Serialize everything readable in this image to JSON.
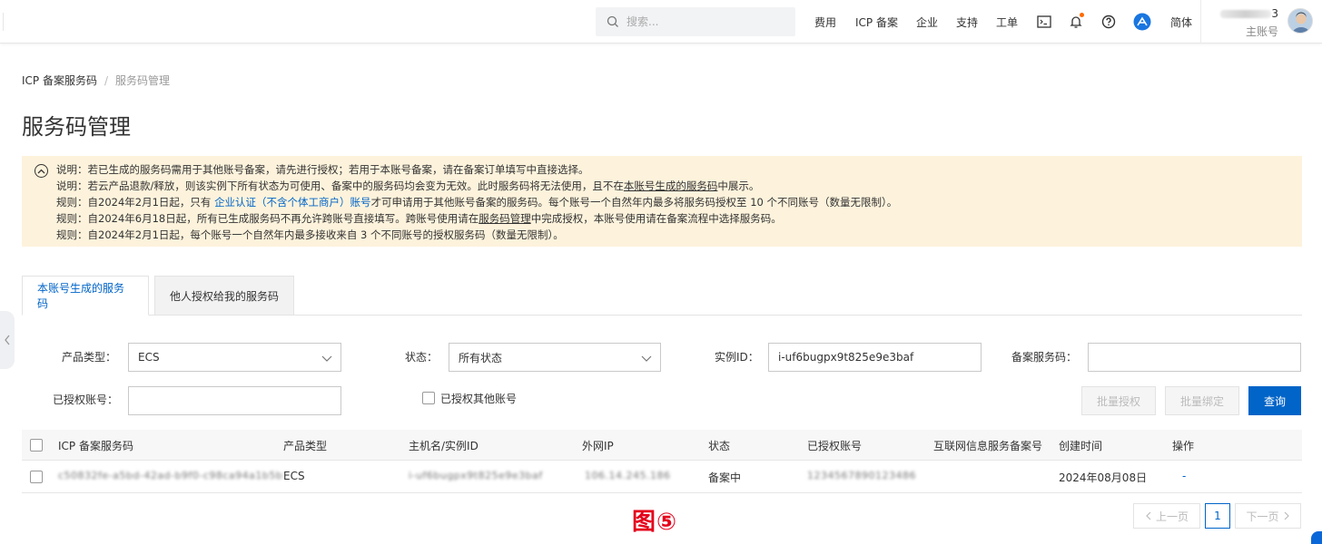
{
  "header": {
    "search_placeholder": "搜索...",
    "nav": [
      "费用",
      "ICP 备案",
      "企业",
      "支持",
      "工单"
    ],
    "lang": "简体",
    "user_suffix": "3",
    "user_role": "主账号",
    "accent": "#ff6a00"
  },
  "breadcrumb": {
    "root": "ICP 备案服务码",
    "sep": "/",
    "current": "服务码管理"
  },
  "page_title": "服务码管理",
  "notice": {
    "line1": "说明：若已生成的服务码需用于其他账号备案，请先进行授权；若用于本账号备案，请在备案订单填写中直接选择。",
    "line2_a": "说明：若云产品退款/释放，则该实例下所有状态为可使用、备案中的服务码均会变为无效。此时服务码将无法使用，且不在",
    "line2_link": "本账号生成的服务码",
    "line2_b": "中展示。",
    "line3_a": "规则：自2024年2月1日起，只有 ",
    "line3_link": "企业认证（不含个体工商户）账号",
    "line3_b": "才可申请用于其他账号备案的服务码。每个账号一个自然年内最多将服务码授权至 10 个不同账号（数量无限制）。",
    "line4_a": "规则：自2024年6月18日起，所有已生成服务码不再允许跨账号直接填写。跨账号使用请在",
    "line4_link": "服务码管理",
    "line4_b": "中完成授权，本账号使用请在备案流程中选择服务码。",
    "line5": "规则：自2024年2月1日起，每个账号一个自然年内最多接收来自 3 个不同账号的授权服务码（数量无限制）。"
  },
  "tabs": [
    {
      "label": "本账号生成的服务码",
      "active": true
    },
    {
      "label": "他人授权给我的服务码",
      "active": false
    }
  ],
  "filters": {
    "product_type_label": "产品类型：",
    "product_type_value": "ECS",
    "status_label": "状态：",
    "status_value": "所有状态",
    "instance_label": "实例ID：",
    "instance_value": "i-uf6bugpx9t825e9e3baf",
    "code_label": "备案服务码：",
    "code_value": "",
    "authorized_label": "已授权账号：",
    "authorized_value": "",
    "checkbox_label": "已授权其他账号"
  },
  "buttons": {
    "batch_auth": "批量授权",
    "batch_bind": "批量绑定",
    "query": "查询"
  },
  "table": {
    "columns": [
      "ICP 备案服务码",
      "产品类型",
      "主机名/实例ID",
      "外网IP",
      "状态",
      "已授权账号",
      "互联网信息服务备案号",
      "创建时间",
      "操作"
    ],
    "rows": [
      {
        "code": "c50832fe-a5bd-42ad-b9f0-c98ca94a1b5b",
        "product": "ECS",
        "instance": "i-uf6bugpx9t825e9e3baf",
        "ip": "106.14.245.186",
        "status": "备案中",
        "authorized": "1234567890123486",
        "icp_no": "",
        "created": "2024年08月08日",
        "action": "-"
      }
    ]
  },
  "figure_label": "图⑤",
  "pagination": {
    "prev": "上一页",
    "page": "1",
    "next": "下一页"
  }
}
